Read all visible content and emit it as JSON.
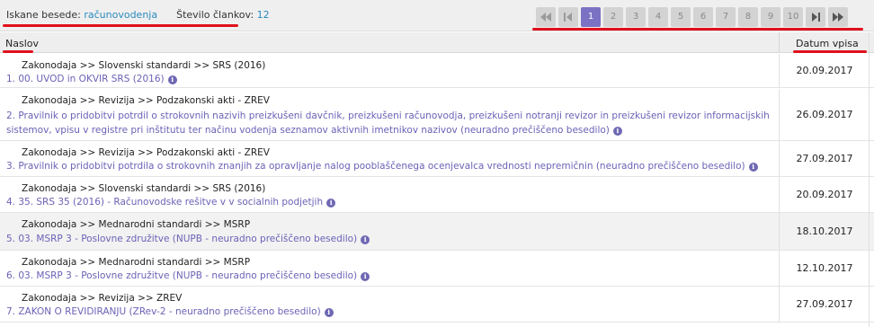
{
  "search": {
    "words_label": "Iskane besede:",
    "words_value": "računovodenja",
    "count_label": "Število člankov:",
    "count_value": "12"
  },
  "pager": {
    "pages": [
      "1",
      "2",
      "3",
      "4",
      "5",
      "6",
      "7",
      "8",
      "9",
      "10"
    ],
    "active_page": "1",
    "nav_icons": [
      "first-page-icon",
      "prev-page-icon",
      "next-page-icon",
      "last-page-icon"
    ]
  },
  "table": {
    "col_title": "Naslov",
    "col_date": "Datum vpisa",
    "rows": [
      {
        "num": "1.",
        "crumb": "Zakonodaja >> Slovenski standardi >> SRS (2016)",
        "title": "00. UVOD in OKVIR SRS (2016)",
        "date": "20.09.2017"
      },
      {
        "num": "2.",
        "crumb": "Zakonodaja >> Revizija >> Podzakonski akti - ZREV",
        "title": "Pravilnik o pridobitvi potrdil o strokovnih nazivih preizkušeni davčnik, preizkušeni računovodja, preizkušeni notranji revizor in preizkušeni revizor informacijskih sistemov, vpisu v registre pri inštitutu ter načinu vodenja seznamov aktivnih imetnikov nazivov (neuradno prečiščeno besedilo)",
        "date": "26.09.2017"
      },
      {
        "num": "3.",
        "crumb": "Zakonodaja >> Revizija >> Podzakonski akti - ZREV",
        "title": "Pravilnik o pridobitvi potrdila o strokovnih znanjih za opravljanje nalog pooblaščenega ocenjevalca vrednosti nepremičnin (neuradno prečiščeno besedilo)",
        "date": "27.09.2017"
      },
      {
        "num": "4.",
        "crumb": "Zakonodaja >> Slovenski standardi >> SRS (2016)",
        "title": "35. SRS 35 (2016) - Računovodske rešitve v v socialnih podjetjih",
        "date": "20.09.2017"
      },
      {
        "num": "5.",
        "crumb": "Zakonodaja >> Mednarodni standardi >> MSRP",
        "title": "03. MSRP 3 - Poslovne združitve (NUPB - neuradno prečiščeno besedilo)",
        "date": "18.10.2017"
      },
      {
        "num": "6.",
        "crumb": "Zakonodaja >> Mednarodni standardi >> MSRP",
        "title": "03. MSRP 3 - Poslovne združitve (NUPB - neuradno prečiščeno besedilo)",
        "date": "12.10.2017"
      },
      {
        "num": "7.",
        "crumb": "Zakonodaja >> Revizija >> ZREV",
        "title": "ZAKON O REVIDIRANJU (ZRev-2 - neuradno prečiščeno besedilo)",
        "date": "27.09.2017"
      }
    ]
  }
}
